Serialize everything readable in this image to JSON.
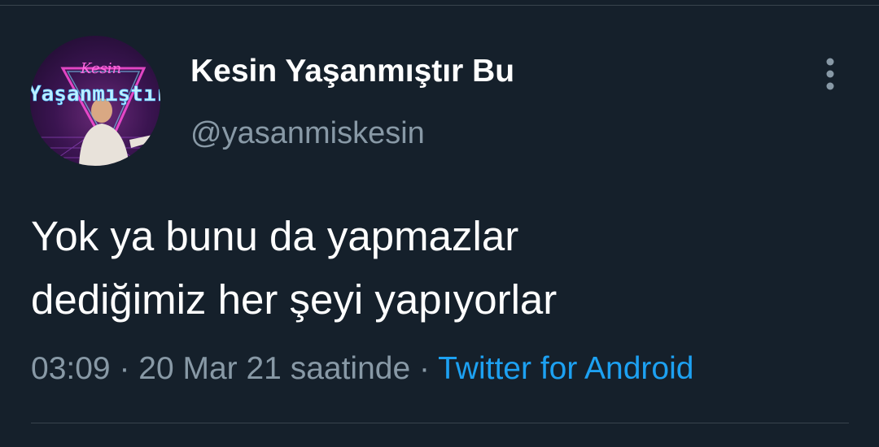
{
  "tweet": {
    "author": {
      "display_name": "Kesin Yaşanmıştır Bu",
      "handle": "@yasanmiskesin",
      "avatar_logo_text": [
        "Kesin",
        "Yaşanmıştır"
      ]
    },
    "text_lines": [
      "Yok ya bunu da yapmazlar",
      "dediğimiz her şeyi yapıyorlar"
    ],
    "time": "03:09",
    "date": "20 Mar 21 saatinde",
    "separator": " · ",
    "source": "Twitter for Android",
    "more_icon": "more-vertical-icon"
  },
  "colors": {
    "background": "#15202b",
    "text_primary": "#ffffff",
    "text_secondary": "#8899a6",
    "link": "#1da1f2",
    "divider": "#38444d"
  }
}
